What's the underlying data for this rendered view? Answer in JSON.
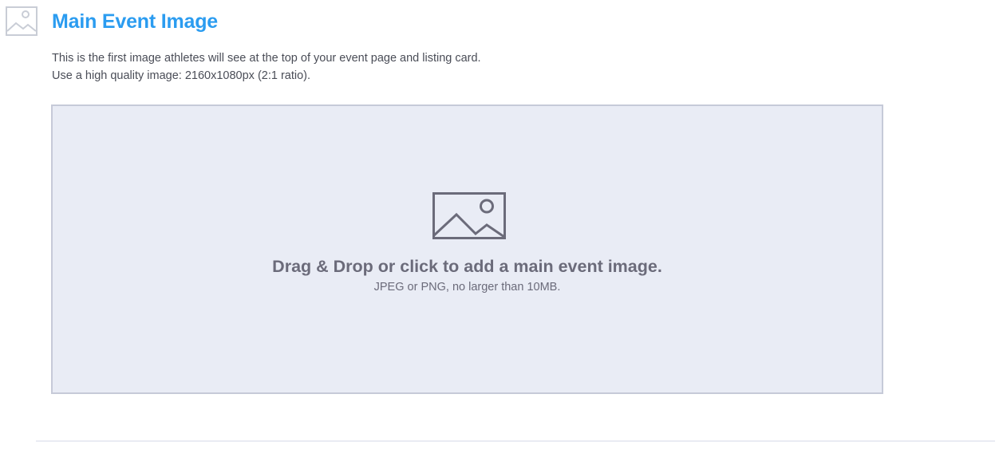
{
  "section": {
    "title": "Main Event Image",
    "icon": "image-icon"
  },
  "description": {
    "line1": "This is the first image athletes will see at the top of your event page and listing card.",
    "line2": "Use a high quality image: 2160x1080px (2:1 ratio)."
  },
  "dropzone": {
    "icon": "image-placeholder-icon",
    "title": "Drag & Drop or click to add a main event image.",
    "subtitle": "JPEG or PNG, no larger than 10MB."
  },
  "colors": {
    "accent": "#2b9cf0",
    "text_body": "#4a4d57",
    "dropzone_bg": "#e9ecf5",
    "dropzone_border": "#c6cad8",
    "dropzone_text": "#6b6b7a",
    "header_icon": "#c9cdd6",
    "divider": "#e9ebf3"
  }
}
